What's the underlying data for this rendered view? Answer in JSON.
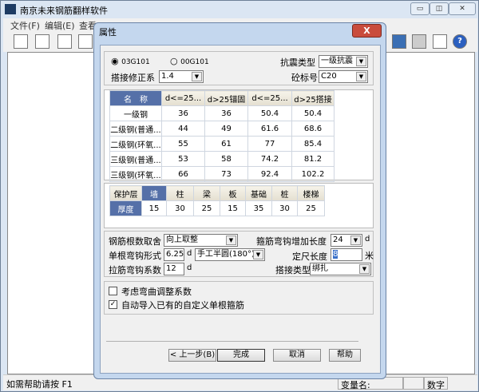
{
  "app": {
    "title": "南京未来钢筋翻样软件",
    "min": "▭",
    "max": "◫",
    "close": "✕"
  },
  "menu": [
    "文件(F)",
    "编辑(E)",
    "查看"
  ],
  "toolbar_right": [
    "calculator-icon",
    "keyboard-icon",
    "book-icon",
    "help-icon"
  ],
  "dialog": {
    "title": "属性",
    "close": "X",
    "standard_options": [
      "03G101",
      "00G101"
    ],
    "standard_selected": "03G101",
    "seismic_label": "抗震类型",
    "seismic_value": "一级抗震",
    "lap_factor_label": "搭接修正系",
    "lap_factor_value": "1.4",
    "concrete_label": "砼标号",
    "concrete_value": "C20",
    "anchor_table": {
      "headers": [
        "名　称",
        "d<=25...",
        "d>25锚固",
        "d<=25...",
        "d>25搭接"
      ],
      "rows": [
        [
          "一级钢",
          "36",
          "36",
          "50.4",
          "50.4"
        ],
        [
          "二级钢(普通...",
          "44",
          "49",
          "61.6",
          "68.6"
        ],
        [
          "二级钢(环氧...",
          "55",
          "61",
          "77",
          "85.4"
        ],
        [
          "三级钢(普通...",
          "53",
          "58",
          "74.2",
          "81.2"
        ],
        [
          "三级钢(环氧...",
          "66",
          "73",
          "92.4",
          "102.2"
        ]
      ]
    },
    "cover_table": {
      "headers": [
        "保护层",
        "墙",
        "柱",
        "梁",
        "板",
        "基础",
        "桩",
        "楼梯"
      ],
      "row": [
        "厚度",
        "15",
        "30",
        "25",
        "15",
        "35",
        "30",
        "25"
      ]
    },
    "rounding_label": "钢筋根数取舍",
    "rounding_value": "向上取整",
    "stirrup_hook_label": "箍筋弯钩增加长度",
    "stirrup_hook_value": "24",
    "unit_d": "d",
    "hook_form_label": "单根弯钩形式",
    "hook_form_num": "6.25",
    "hook_form_value": "手工半圆(180°)",
    "fixed_len_label": "定尺长度",
    "fixed_len_value": "8",
    "unit_m": "米",
    "tie_hook_label": "拉筋弯钩系数",
    "tie_hook_value": "12",
    "lap_type_label": "搭接类型",
    "lap_type_value": "绑扎",
    "check1": {
      "label": "考虑弯曲调整系数",
      "checked": false
    },
    "check2": {
      "label": "自动导入已有的自定义单根箍筋",
      "checked": true
    },
    "buttons": {
      "back": "< 上一步(B)",
      "finish": "完成",
      "cancel": "取消",
      "help": "帮助"
    }
  },
  "status": {
    "hint": "如需帮助请按 F1",
    "var": "变量名:",
    "num": "数字"
  }
}
